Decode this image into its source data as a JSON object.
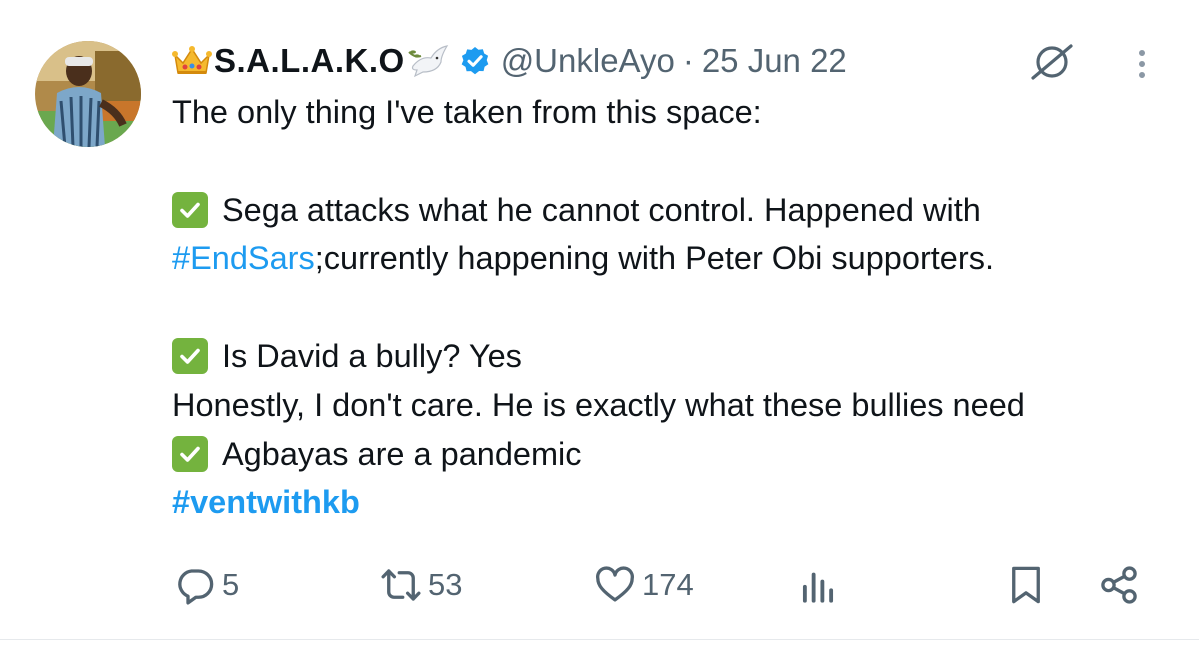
{
  "tweet": {
    "author": {
      "display_name": "S.A.L.A.K.O",
      "handle": "@UnkleAyo",
      "separator": "·",
      "date": "25 Jun 22"
    },
    "lines": [
      {
        "kind": "text",
        "text": "The only thing I've taken from this space:"
      },
      {
        "kind": "blank"
      },
      {
        "kind": "check",
        "text": "Sega attacks what he cannot control. Happened with"
      },
      {
        "kind": "mixed",
        "link": "#EndSars",
        "text": ";currently happening with Peter Obi supporters."
      },
      {
        "kind": "blank"
      },
      {
        "kind": "check",
        "text": "Is David a bully? Yes"
      },
      {
        "kind": "text",
        "text": "Honestly, I don't care. He is exactly what these bullies need"
      },
      {
        "kind": "check",
        "text": "Agbayas are a pandemic"
      },
      {
        "kind": "hashtag",
        "text": "#ventwithkb"
      }
    ],
    "metrics": {
      "replies": "5",
      "reposts": "53",
      "likes": "174"
    },
    "icons": {
      "emoji_prefix": "crown-icon",
      "emoji_suffix": "dove-icon",
      "badge": "verified-icon",
      "grok": "grok-icon",
      "more": "more-icon",
      "reply": "reply-icon",
      "repost": "repost-icon",
      "like": "like-icon",
      "views": "views-icon",
      "bookmark": "bookmark-icon",
      "share": "share-icon",
      "check": "check-mark-icon"
    },
    "colors": {
      "text": "#0f1419",
      "secondary": "#536471",
      "link": "#1d9bf0",
      "check_bg": "#74b33e"
    }
  }
}
